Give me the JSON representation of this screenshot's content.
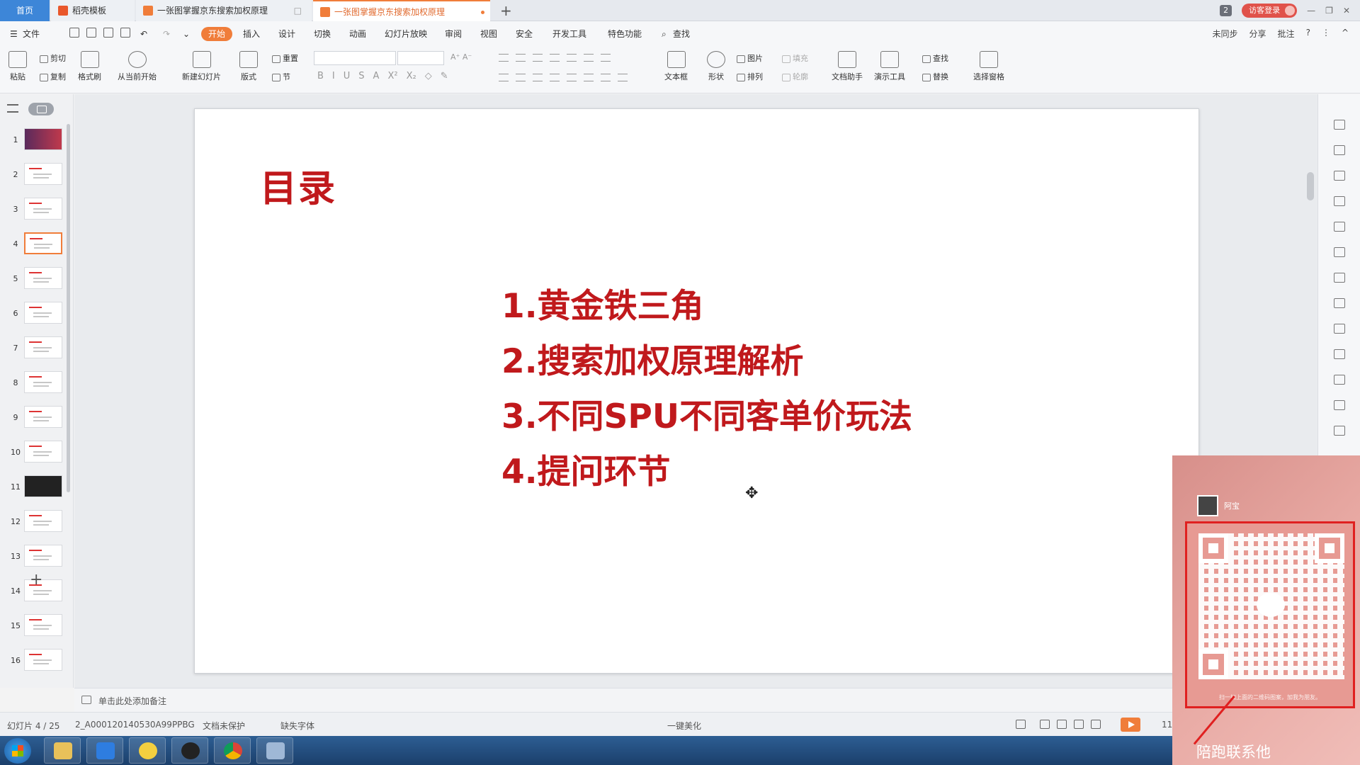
{
  "tabs": {
    "home": "首页",
    "items": [
      {
        "label": "稻壳模板"
      },
      {
        "label": "一张图掌握京东搜索加权原理"
      },
      {
        "label": "一张图掌握京东搜索加权原理"
      }
    ],
    "new_tab": "+",
    "badge": "2",
    "login": "访客登录"
  },
  "menu": {
    "file": "文件",
    "items": [
      "开始",
      "插入",
      "设计",
      "切换",
      "动画",
      "幻灯片放映",
      "审阅",
      "视图",
      "安全",
      "开发工具",
      "特色功能"
    ],
    "search": "查找",
    "right": [
      "未同步",
      "分享",
      "批注"
    ]
  },
  "ribbon": {
    "paste": "粘贴",
    "cut": "剪切",
    "copy": "复制",
    "format_painter": "格式刷",
    "from_current": "从当前开始",
    "new_slide": "新建幻灯片",
    "layout": "版式",
    "reset": "重置",
    "section": "节",
    "textbox": "文本框",
    "shape": "形状",
    "picture": "图片",
    "fill": "填充",
    "arrange": "排列",
    "outline": "轮廓",
    "doc_assistant": "文档助手",
    "present_tools": "演示工具",
    "find": "查找",
    "replace": "替换",
    "select_pane": "选择窗格"
  },
  "thumbnails": [
    "1",
    "2",
    "3",
    "4",
    "5",
    "6",
    "7",
    "8",
    "9",
    "10",
    "11",
    "12",
    "13",
    "14",
    "15",
    "16"
  ],
  "slide": {
    "title": "目录",
    "items": [
      "1.黄金铁三角",
      "2.搜索加权原理解析",
      "3.不同SPU不同客单价玩法",
      "4.提问环节"
    ]
  },
  "notes_placeholder": "单击此处添加备注",
  "status": {
    "slide_counter": "幻灯片 4 / 25",
    "file_id": "2_A000120140530A99PPBG",
    "doc_protect": "文档未保护",
    "missing_font": "缺失字体",
    "beautify": "一键美化",
    "zoom_partial": "11"
  },
  "overlay": {
    "name": "阿宝",
    "caption": "扫一扫上面的二维码图案，加我为朋友。",
    "label": "陪跑联系他"
  },
  "colors": {
    "accent": "#f07d3a",
    "slide_red": "#c0191c",
    "home_tab": "#3d86d8"
  }
}
